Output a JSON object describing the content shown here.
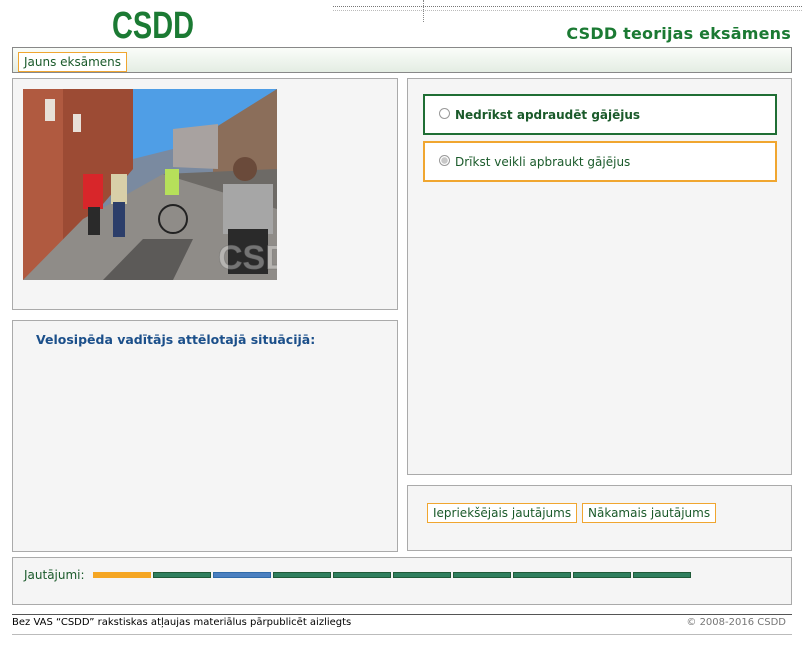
{
  "header": {
    "logo_text": "CSDD",
    "site_title": "CSDD teorijas eksāmens"
  },
  "nav": {
    "new_exam_label": "Jauns eksāmens"
  },
  "question": {
    "text": "Velosipēda vadītājs attēlotajā situācijā:",
    "image_watermark": "CSDD"
  },
  "answers": [
    {
      "label": "Nedrīkst apdraudēt gājējus",
      "state": "active"
    },
    {
      "label": "Drīkst veikli apbraukt gājējus",
      "state": "selected"
    }
  ],
  "navigation": {
    "prev_label": "Iepriekšējais jautājums",
    "next_label": "Nākamais jautājums"
  },
  "progress": {
    "label": "Jautājumi:",
    "segments": [
      "current",
      "done",
      "answered",
      "done",
      "done",
      "done",
      "done",
      "done",
      "done",
      "done"
    ],
    "colors": {
      "current": "#f5a623",
      "done": "#2f7f5e",
      "answered": "#4a7fc0"
    }
  },
  "footer": {
    "left": "Bez VAS “CSDD” rakstiskas atļaujas materiālus pārpublicēt aizliegts",
    "right": "© 2008-2016 CSDD"
  },
  "colors": {
    "brand_green": "#1b7a33",
    "accent_orange": "#f0a630",
    "question_blue": "#1b4f8a"
  }
}
